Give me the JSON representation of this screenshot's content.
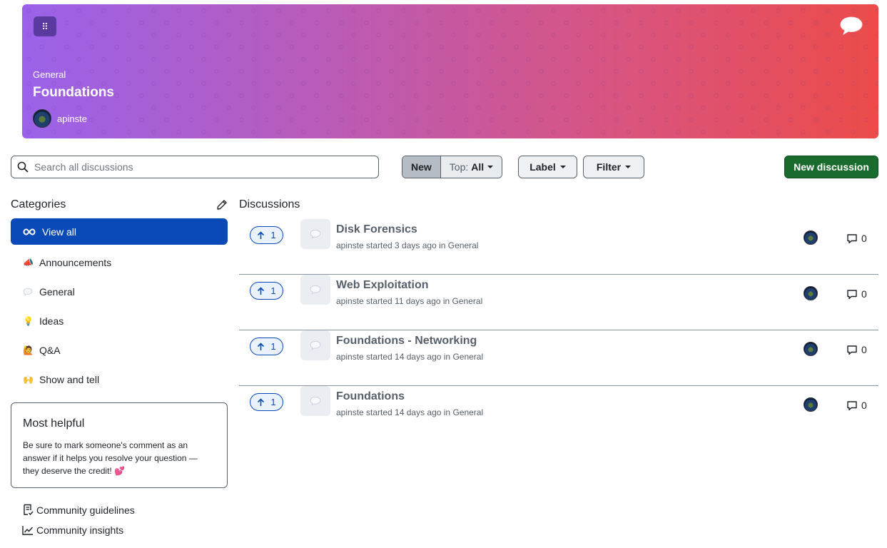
{
  "banner": {
    "category": "General",
    "title": "Foundations",
    "username": "apinste"
  },
  "toolbar": {
    "search_placeholder": "Search all discussions",
    "sort_new": "New",
    "sort_top_prefix": "Top:",
    "sort_top_value": "All",
    "label_button": "Label",
    "filter_button": "Filter",
    "new_discussion_button": "New discussion"
  },
  "sidebar": {
    "heading": "Categories",
    "categories": [
      {
        "label": "View all",
        "icon": "infinity-icon"
      },
      {
        "label": "Announcements",
        "icon": "megaphone-icon"
      },
      {
        "label": "General",
        "icon": "speech-bubble-icon"
      },
      {
        "label": "Ideas",
        "icon": "lightbulb-icon"
      },
      {
        "label": "Q&A",
        "icon": "person-raising-hand-icon"
      },
      {
        "label": "Show and tell",
        "icon": "raised-hands-icon"
      }
    ],
    "most_helpful": {
      "title": "Most helpful",
      "text": "Be sure to mark someone's comment as an answer if it helps you resolve your question — they deserve the credit! 💕"
    },
    "links": [
      {
        "label": "Community guidelines",
        "icon": "guidelines-icon"
      },
      {
        "label": "Community insights",
        "icon": "graph-icon"
      }
    ]
  },
  "discussions": {
    "heading": "Discussions",
    "items": [
      {
        "title": "Disk Forensics",
        "meta": "apinste started 3 days ago in General",
        "votes": "1",
        "comments": "0"
      },
      {
        "title": "Web Exploitation",
        "meta": "apinste started 11 days ago in General",
        "votes": "1",
        "comments": "0"
      },
      {
        "title": "Foundations - Networking",
        "meta": "apinste started 14 days ago in General",
        "votes": "1",
        "comments": "0"
      },
      {
        "title": "Foundations",
        "meta": "apinste started 14 days ago in General",
        "votes": "1",
        "comments": "0"
      }
    ]
  },
  "colors": {
    "accent": "#0a4ab8",
    "primary_button": "#1a6b2e"
  }
}
